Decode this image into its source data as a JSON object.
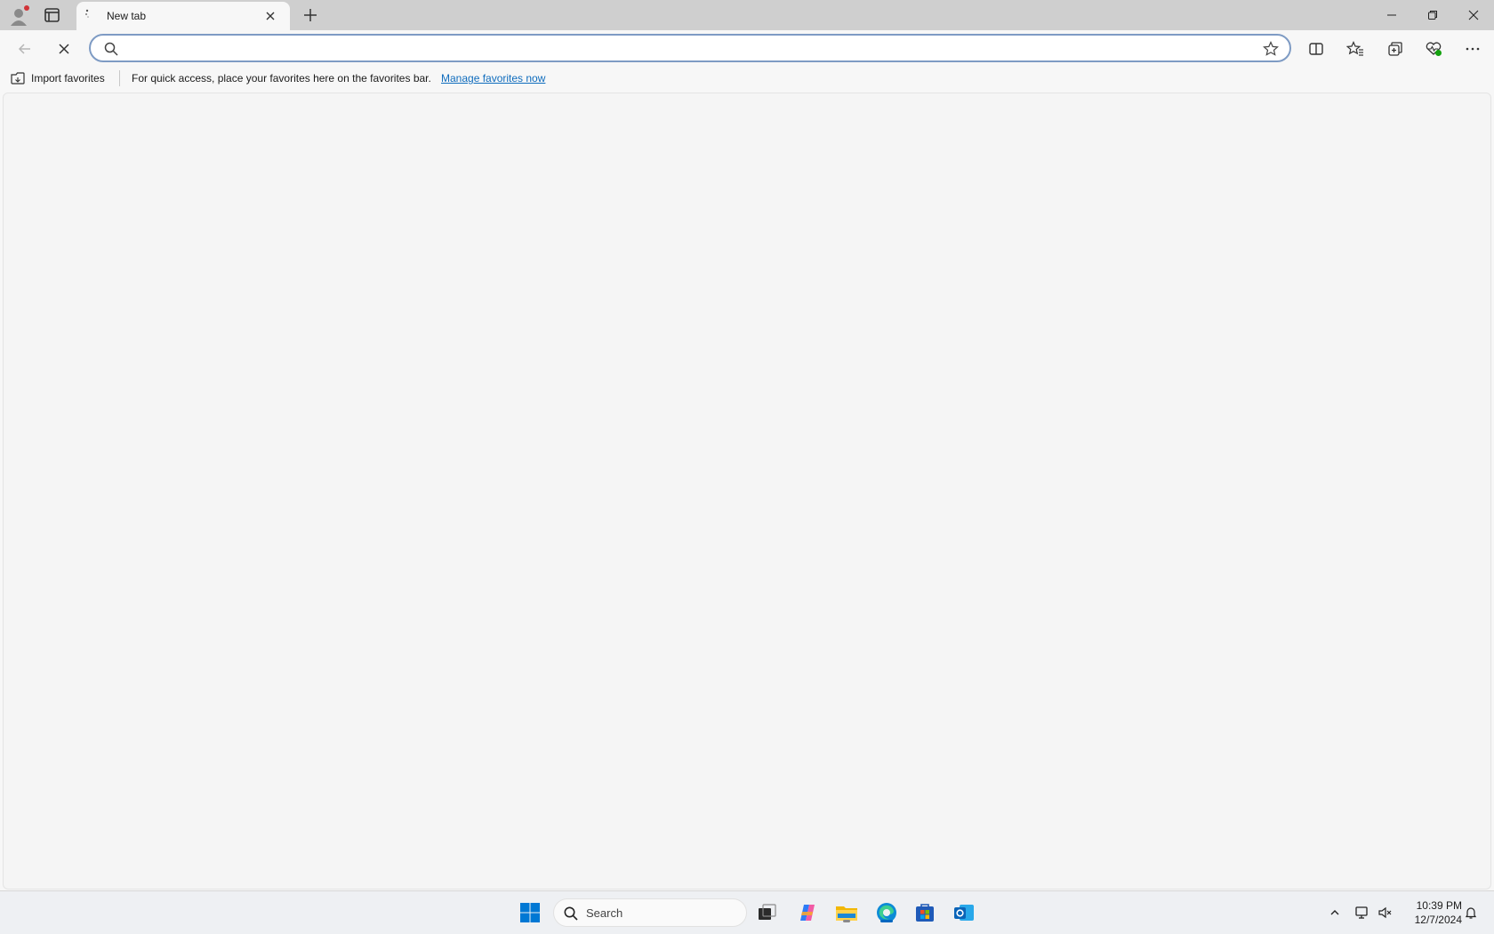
{
  "browser": {
    "tab": {
      "title": "New tab"
    },
    "address_bar": {
      "value": "",
      "placeholder": ""
    },
    "favorites_bar": {
      "import_label": "Import favorites",
      "hint": "For quick access, place your favorites here on the favorites bar.",
      "manage_link": "Manage favorites now"
    }
  },
  "taskbar": {
    "search_label": "Search",
    "clock_time": "10:39 PM",
    "clock_date": "12/7/2024",
    "accent": "#0067c0"
  }
}
